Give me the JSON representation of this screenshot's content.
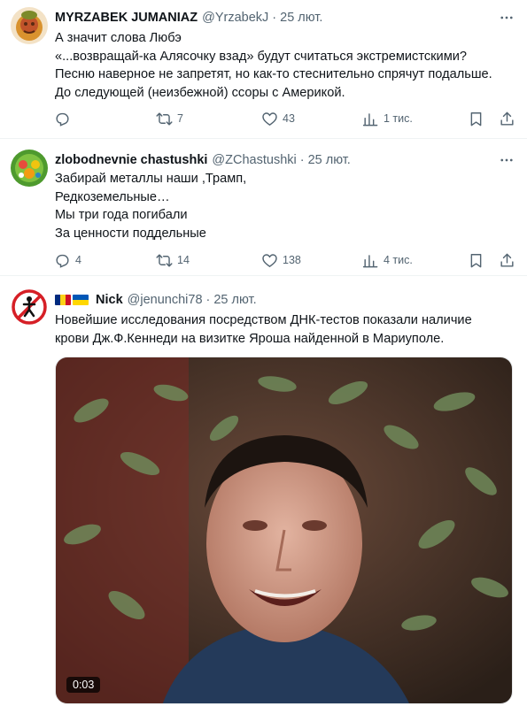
{
  "tweets": [
    {
      "name": "MYRZABEK JUMANIAZ",
      "handle": "@YrzabekJ",
      "separator": "·",
      "date": "25 лют.",
      "lines": [
        "А значит слова Любэ",
        "«...возвращай-ка Алясочку взад» будут считаться экстремистскими?",
        "Песню наверное не запретят, но как-то стеснительно спрячут подальше.",
        "До следующей (неизбежной) ссоры с Америкой."
      ],
      "replies": "",
      "retweets": "7",
      "likes": "43",
      "views": "1 тис."
    },
    {
      "name": "zlobodnevnie chastushki",
      "handle": "@ZChastushki",
      "separator": "·",
      "date": "25 лют.",
      "lines": [
        "Забирай металлы наши ,Трамп,",
        "Редкоземельные…",
        "Мы три года погибали",
        "За ценности поддельные"
      ],
      "replies": "4",
      "retweets": "14",
      "likes": "138",
      "views": "4 тис."
    },
    {
      "name": "Nick",
      "handle": "@jenunchi78",
      "separator": "·",
      "date": "25 лют.",
      "lines": [
        "Новейшие исследования посредством ДНК-тестов показали наличие",
        "крови Дж.Ф.Кеннеди на визитке Яроша найденной в Мариуполе."
      ],
      "video_duration": "0:03"
    }
  ],
  "colors": {
    "text": "#0f1419",
    "secondary": "#536471",
    "divider": "#eff3f4"
  },
  "icons": [
    "more-icon",
    "reply-icon",
    "retweet-icon",
    "like-icon",
    "views-icon",
    "bookmark-icon",
    "share-icon"
  ]
}
